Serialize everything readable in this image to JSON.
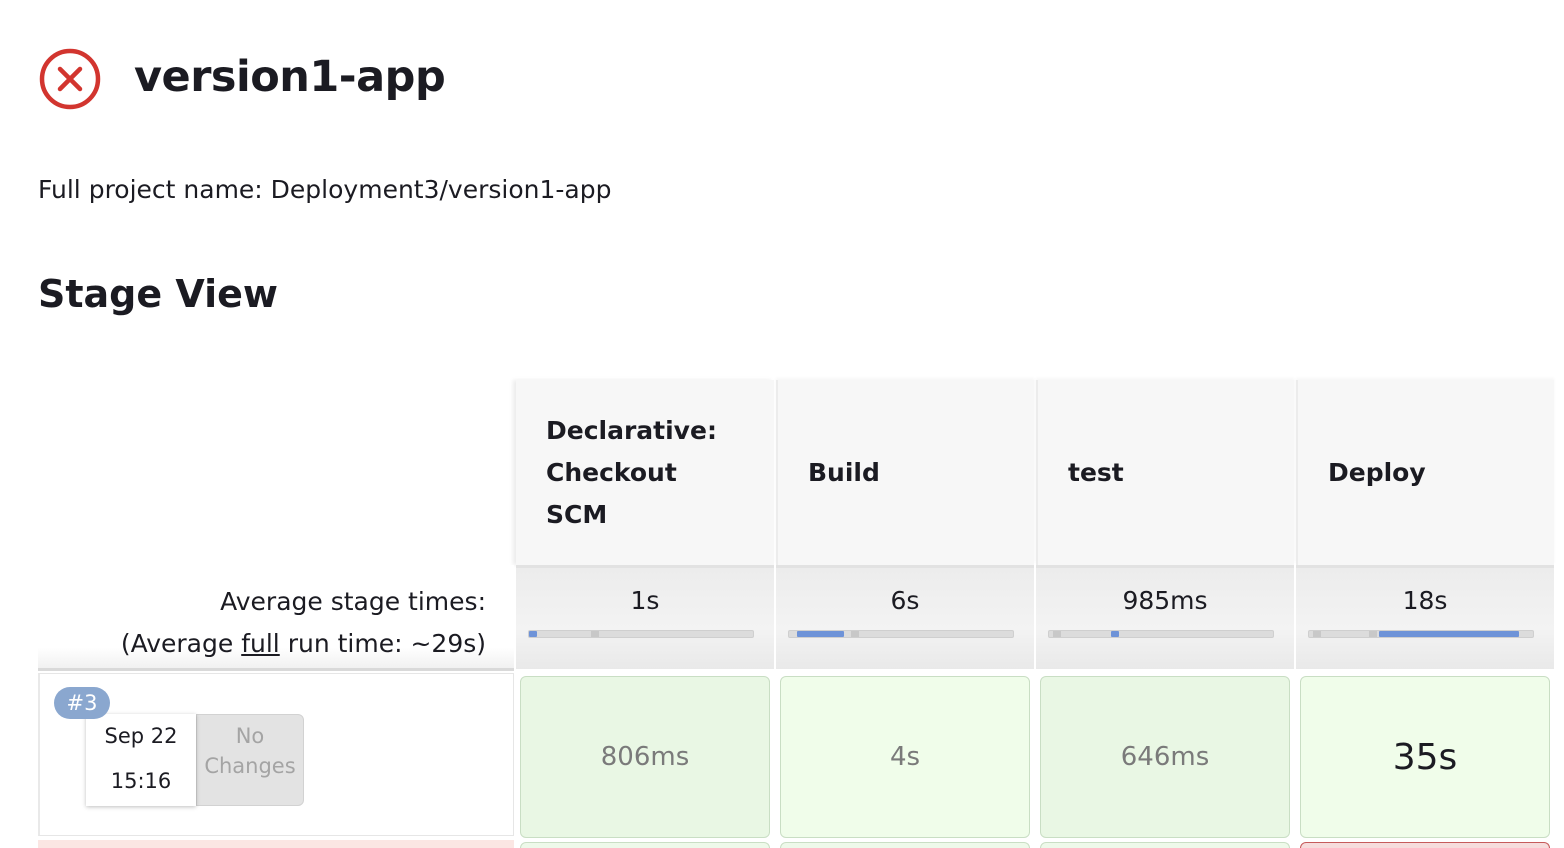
{
  "job": {
    "title": "version1-app",
    "status": "failed",
    "status_icon": "error-circle-x-icon",
    "status_color": "#d2352f",
    "full_name": "Full project name: Deployment3/version1-app"
  },
  "stage_view": {
    "title": "Stage View",
    "stages": [
      {
        "name": "Declarative: Checkout SCM",
        "avg_time": "1s",
        "avg_fraction": 0.03
      },
      {
        "name": "Build",
        "avg_time": "6s",
        "avg_fraction": 0.21
      },
      {
        "name": "test",
        "avg_time": "985ms",
        "avg_fraction": 0.03
      },
      {
        "name": "Deploy",
        "avg_time": "18s",
        "avg_fraction": 0.62
      }
    ],
    "avg_label_line1": "Average stage times:",
    "avg_label_line2_prefix": "(Average ",
    "avg_label_line2_link": "full",
    "avg_label_line2_suffix": " run time: ~29s)",
    "runs": [
      {
        "badge": "#3",
        "date": "Sep 22",
        "time": "15:16",
        "changes": "No Changes",
        "stage_times": [
          "806ms",
          "4s",
          "646ms",
          "35s"
        ]
      }
    ]
  },
  "colors": {
    "success_bg": "#e9f7e4",
    "failure_accent": "#c65b5b",
    "badge_bg": "#8aa7cf",
    "bar_fill": "#6e93d8"
  }
}
